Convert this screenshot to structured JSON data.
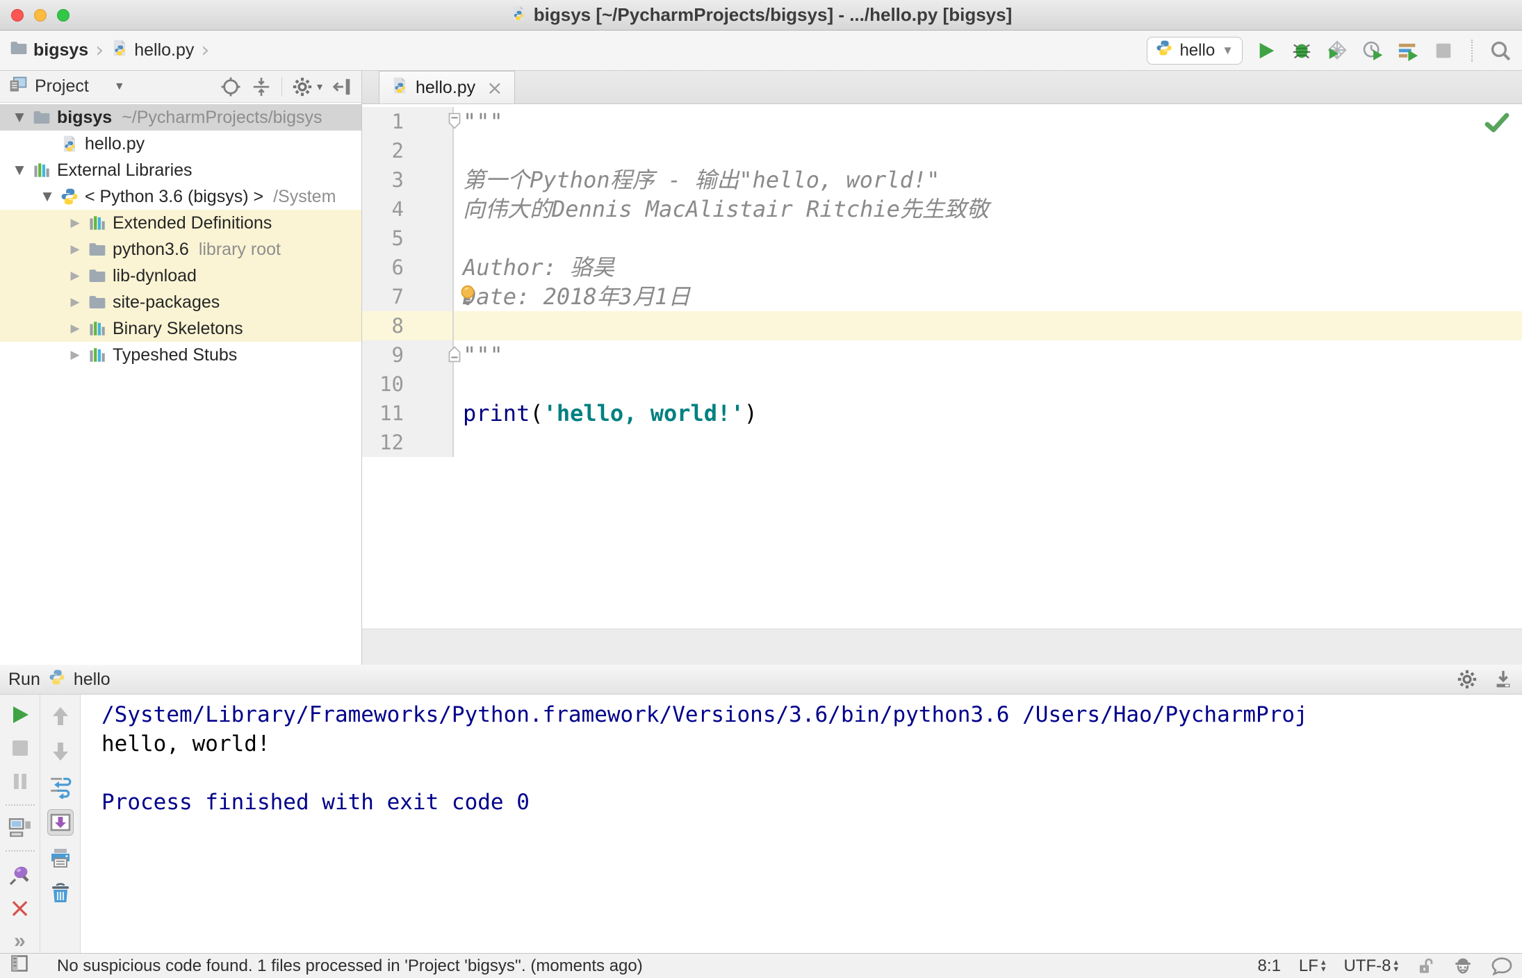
{
  "window": {
    "title": "bigsys [~/PycharmProjects/bigsys] - .../hello.py [bigsys]"
  },
  "navbar": {
    "breadcrumbs": [
      {
        "label": "bigsys",
        "icon": "folder"
      },
      {
        "label": "hello.py",
        "icon": "python-file"
      }
    ],
    "run_config": {
      "label": "hello"
    }
  },
  "project_panel": {
    "title": "Project",
    "tree": [
      {
        "label": "bigsys",
        "suffix": "~/PycharmProjects/bigsys",
        "icon": "folder",
        "depth": 0,
        "arrow": "expanded",
        "selected": true,
        "bold": true
      },
      {
        "label": "hello.py",
        "icon": "pyfile",
        "depth": 1,
        "arrow": "none"
      },
      {
        "label": "External Libraries",
        "icon": "library",
        "depth": 0,
        "arrow": "expanded"
      },
      {
        "label": "< Python 3.6 (bigsys) >",
        "suffix": "/System",
        "icon": "python",
        "depth": 1,
        "arrow": "expanded"
      },
      {
        "label": "Extended Definitions",
        "icon": "library",
        "depth": 2,
        "arrow": "collapsed",
        "highlighted": true
      },
      {
        "label": "python3.6",
        "suffix": "library root",
        "icon": "folder",
        "depth": 2,
        "arrow": "collapsed",
        "highlighted": true
      },
      {
        "label": "lib-dynload",
        "icon": "folder",
        "depth": 2,
        "arrow": "collapsed",
        "highlighted": true
      },
      {
        "label": "site-packages",
        "icon": "folder",
        "depth": 2,
        "arrow": "collapsed",
        "highlighted": true
      },
      {
        "label": "Binary Skeletons",
        "icon": "library",
        "depth": 2,
        "arrow": "collapsed",
        "highlighted": true
      },
      {
        "label": "Typeshed Stubs",
        "icon": "library",
        "depth": 2,
        "arrow": "collapsed"
      }
    ]
  },
  "editor": {
    "tab": {
      "label": "hello.py"
    },
    "inspection_status": "ok",
    "lines": [
      {
        "n": 1,
        "fold": "top",
        "segs": [
          {
            "t": "\"\"\"",
            "c": "doc"
          }
        ]
      },
      {
        "n": 2,
        "segs": []
      },
      {
        "n": 3,
        "segs": [
          {
            "t": "第一个Python程序 - 输出\"hello, world!\"",
            "c": "doc"
          }
        ]
      },
      {
        "n": 4,
        "segs": [
          {
            "t": "向伟大的Dennis MacAlistair Ritchie先生致敬",
            "c": "doc"
          }
        ]
      },
      {
        "n": 5,
        "segs": []
      },
      {
        "n": 6,
        "segs": [
          {
            "t": "Author: 骆昊",
            "c": "doc"
          }
        ]
      },
      {
        "n": 7,
        "bulb": true,
        "segs": [
          {
            "t": "Date: 2018年3月1日",
            "c": "doc"
          }
        ]
      },
      {
        "n": 8,
        "current": true,
        "segs": []
      },
      {
        "n": 9,
        "fold": "bottom",
        "segs": [
          {
            "t": "\"\"\"",
            "c": "doc"
          }
        ]
      },
      {
        "n": 10,
        "segs": []
      },
      {
        "n": 11,
        "segs": [
          {
            "t": "print",
            "c": "kw"
          },
          {
            "t": "(",
            "c": "plain"
          },
          {
            "t": "'hello, world!'",
            "c": "str"
          },
          {
            "t": ")",
            "c": "plain"
          }
        ]
      },
      {
        "n": 12,
        "segs": []
      }
    ]
  },
  "run_panel": {
    "title": "Run",
    "config": "hello",
    "console": [
      {
        "text": "/System/Library/Frameworks/Python.framework/Versions/3.6/bin/python3.6 /Users/Hao/PycharmProj",
        "c": "system"
      },
      {
        "text": "hello, world!",
        "c": "stdout"
      },
      {
        "text": "",
        "c": "stdout"
      },
      {
        "text": "Process finished with exit code 0",
        "c": "system"
      }
    ]
  },
  "status_bar": {
    "message": "No suspicious code found. 1 files processed in 'Project 'bigsys''. (moments ago)",
    "caret": "8:1",
    "line_separator": "LF",
    "encoding": "UTF-8"
  },
  "colors": {
    "run_green": "#3fa344",
    "keyword_navy": "#000080",
    "string_teal": "#008080",
    "console_system_navy": "#00008b",
    "current_line_yellow": "#fcf7da",
    "library_highlight_yellow": "#faf4d4",
    "selection_gray": "#d4d4d4"
  },
  "icon_names": [
    "python-icon",
    "python-file-icon",
    "folder-icon",
    "library-icon",
    "run-icon",
    "debug-bug-icon",
    "coverage-icon",
    "profiler-icon",
    "concurrency-icon",
    "stop-icon",
    "search-icon",
    "locate-target-icon",
    "collapse-all-icon",
    "gear-icon",
    "hide-panel-icon",
    "rerun-icon",
    "pause-icon",
    "show-console-icon",
    "pin-icon",
    "close-icon",
    "more-icon",
    "up-arrow-icon",
    "down-arrow-icon",
    "soft-wrap-icon",
    "scroll-to-end-icon",
    "print-icon",
    "clear-trash-icon",
    "check-ok-icon",
    "lock-icon",
    "hector-icon",
    "feedback-bubble-icon",
    "toolwindow-toggle-icon",
    "bulb-icon"
  ]
}
